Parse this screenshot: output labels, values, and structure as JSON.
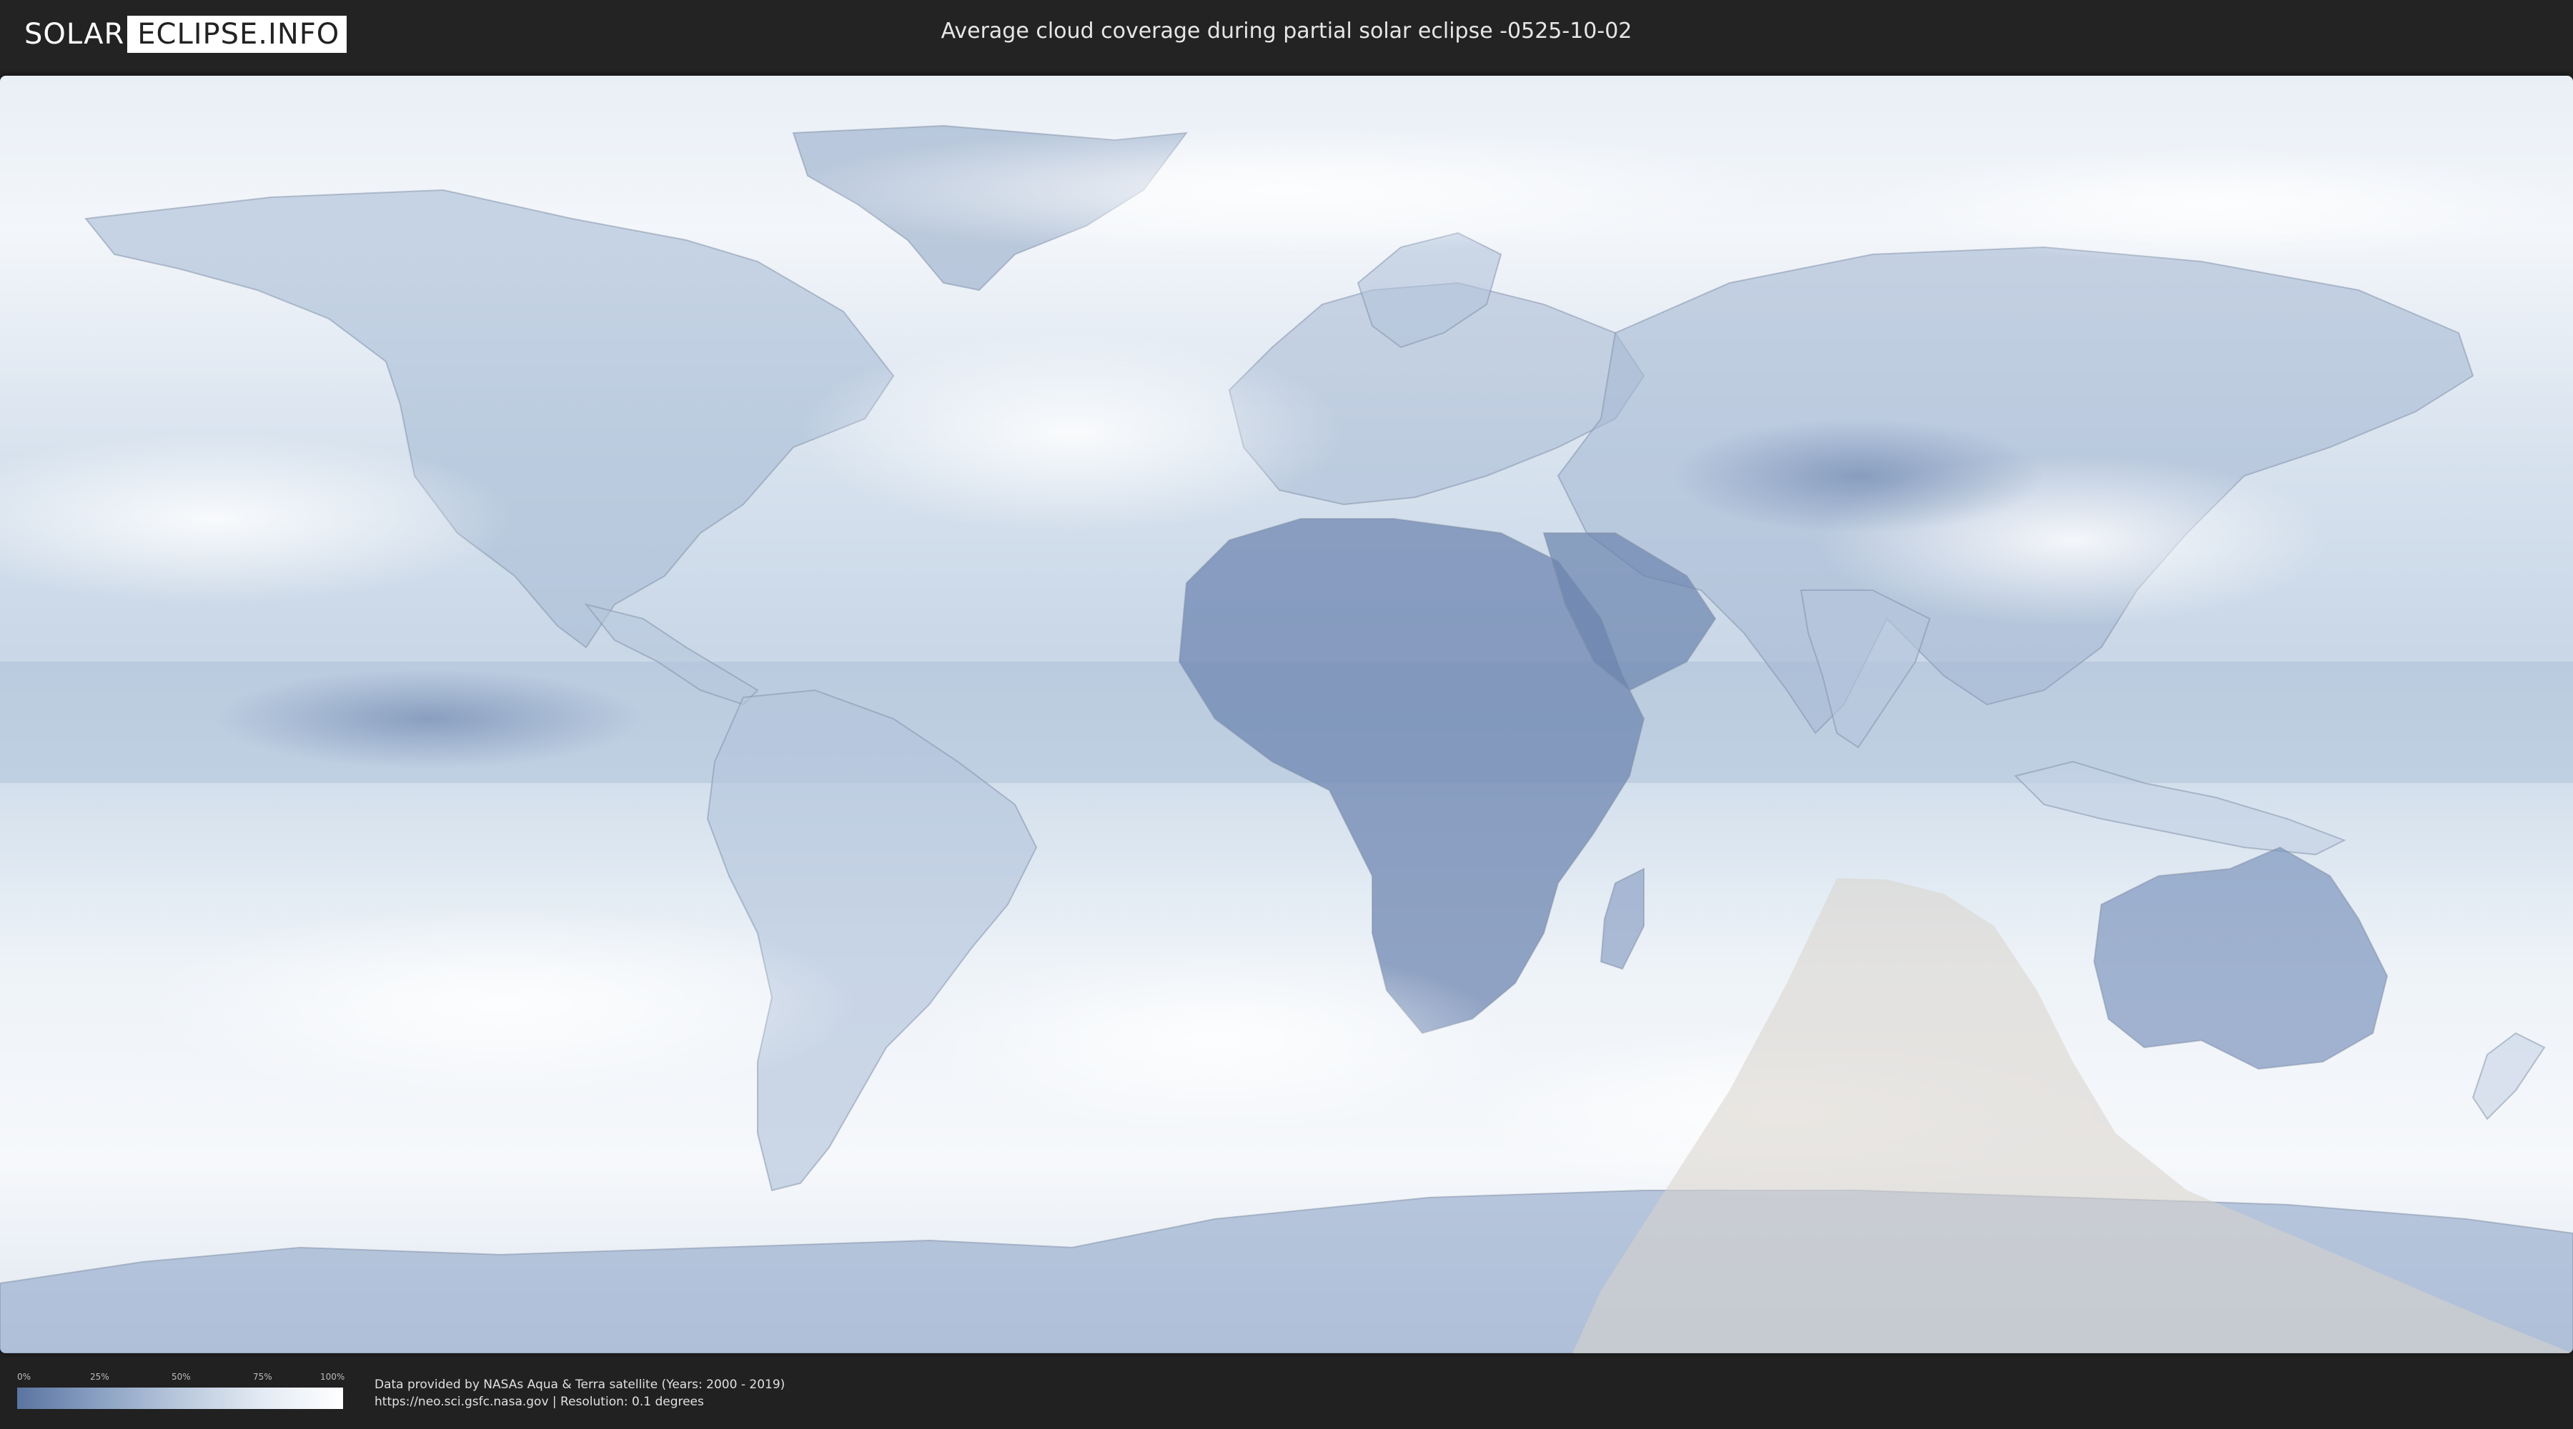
{
  "header": {
    "logo_left": "SOLAR",
    "logo_right": "ECLIPSE.INFO",
    "title": "Average cloud coverage during partial solar eclipse -0525-10-02"
  },
  "map": {
    "ocean_color": "#dfe8f2",
    "cloud_color": "#ffffff",
    "clear_sky_color": "#5b74a0",
    "eclipse_overlay_color": "#d9d4cc"
  },
  "legend": {
    "ticks": [
      "0%",
      "25%",
      "50%",
      "75%",
      "100%"
    ],
    "gradient": [
      "#5b74a0",
      "#8aa1c3",
      "#b9c8dc",
      "#e3eaf3",
      "#ffffff"
    ]
  },
  "footer": {
    "source_line1": "Data provided by NASAs Aqua & Terra satellite (Years: 2000 - 2019)",
    "source_line2": "https://neo.sci.gsfc.nasa.gov | Resolution: 0.1 degrees"
  }
}
